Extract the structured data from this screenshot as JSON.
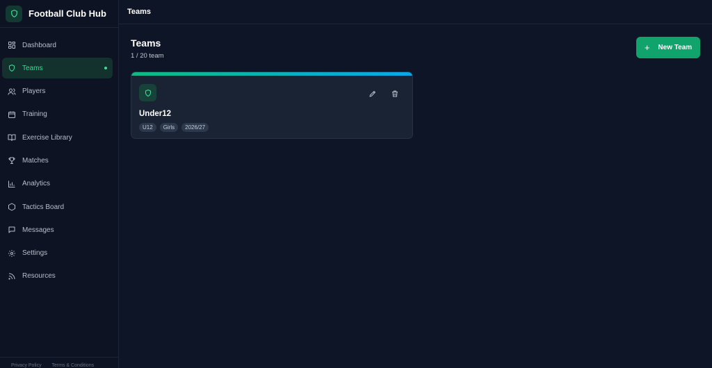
{
  "app": {
    "title": "Football Club Hub",
    "logo_icon": "shield-icon"
  },
  "sidebar": {
    "items": [
      {
        "label": "Dashboard",
        "icon": "dashboard-icon",
        "active": false
      },
      {
        "label": "Teams",
        "icon": "shield-icon",
        "active": true
      },
      {
        "label": "Players",
        "icon": "users-icon",
        "active": false
      },
      {
        "label": "Training",
        "icon": "calendar-icon",
        "active": false
      },
      {
        "label": "Exercise Library",
        "icon": "book-icon",
        "active": false
      },
      {
        "label": "Matches",
        "icon": "trophy-icon",
        "active": false
      },
      {
        "label": "Analytics",
        "icon": "bar-chart-icon",
        "active": false
      },
      {
        "label": "Tactics Board",
        "icon": "hexagon-icon",
        "active": false
      },
      {
        "label": "Messages",
        "icon": "message-icon",
        "active": false
      },
      {
        "label": "Settings",
        "icon": "gear-icon",
        "active": false
      },
      {
        "label": "Resources",
        "icon": "rss-icon",
        "active": false
      }
    ],
    "footer": {
      "privacy": "Privacy Policy",
      "terms": "Terms & Conditions"
    }
  },
  "topbar": {
    "title": "Teams"
  },
  "page": {
    "title": "Teams",
    "subtitle": "1 / 20 team",
    "new_button_label": "New Team",
    "new_button_icon": "plus-icon"
  },
  "teams": [
    {
      "name": "Under12",
      "tags": [
        "U12",
        "Girls",
        "2026/27"
      ],
      "icon": "shield-icon",
      "actions": {
        "edit_icon": "pencil-icon",
        "delete_icon": "trash-icon"
      }
    }
  ],
  "colors": {
    "accent": "#3ddc97",
    "primary_button": "#10a36b",
    "background": "#0e1526",
    "card_strip_start": "#10b981",
    "card_strip_end": "#0ea5e9"
  }
}
